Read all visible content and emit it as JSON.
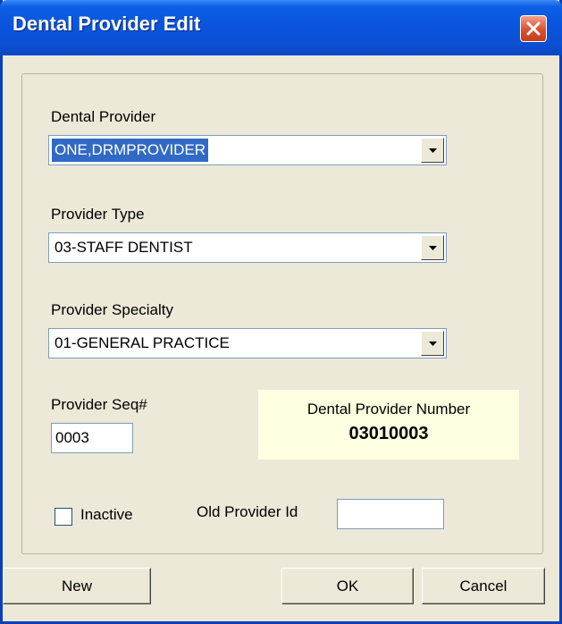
{
  "window": {
    "title": "Dental Provider Edit"
  },
  "form": {
    "dental_provider_label": "Dental Provider",
    "dental_provider_value": "ONE,DRMPROVIDER",
    "provider_type_label": "Provider Type",
    "provider_type_value": "03-STAFF DENTIST",
    "provider_specialty_label": "Provider Specialty",
    "provider_specialty_value": "01-GENERAL PRACTICE",
    "seq_label": "Provider Seq#",
    "seq_value": "0003",
    "number_label": "Dental Provider Number",
    "number_value": "03010003",
    "inactive_label": "Inactive",
    "inactive_checked": false,
    "old_id_label": "Old Provider Id",
    "old_id_value": ""
  },
  "buttons": {
    "new": "New",
    "ok": "OK",
    "cancel": "Cancel"
  },
  "icons": {
    "close": "close-icon",
    "dropdown": "chevron-down-icon"
  },
  "colors": {
    "titlebar": "#0A55DE",
    "selection": "#316AC5",
    "info_panel": "#FFFFE1",
    "close_button": "#D9502E"
  }
}
